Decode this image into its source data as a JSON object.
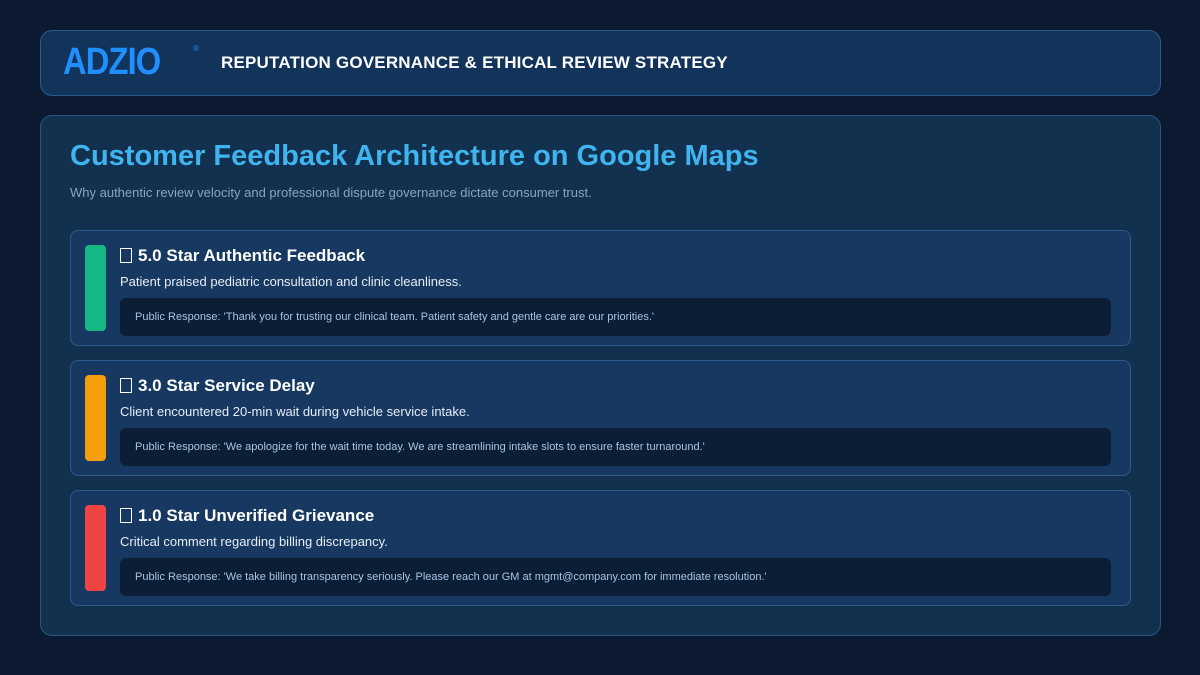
{
  "header": {
    "logo_text": "ADZIO",
    "logo_mark": "®",
    "title": "REPUTATION GOVERNANCE & ETHICAL REVIEW STRATEGY"
  },
  "main": {
    "title": "Customer Feedback Architecture on Google Maps",
    "subtitle": "Why authentic review velocity and professional dispute governance dictate consumer trust."
  },
  "reviews": [
    {
      "icon": "star-icon",
      "title": "5.0 Star Authentic Feedback",
      "description": "Patient praised pediatric consultation and clinic cleanliness.",
      "response": "Public Response: 'Thank you for trusting our clinical team. Patient safety and gentle care are our priorities.'",
      "color": "#14b884"
    },
    {
      "icon": "star-icon",
      "title": "3.0 Star Service Delay",
      "description": "Client encountered 20-min wait during vehicle service intake.",
      "response": "Public Response: 'We apologize for the wait time today. We are streamlining intake slots to ensure faster turnaround.'",
      "color": "#f59e0b"
    },
    {
      "icon": "star-icon",
      "title": "1.0 Star Unverified Grievance",
      "description": "Critical comment regarding billing discrepancy.",
      "response": "Public Response: 'We take billing transparency seriously. Please reach our GM at mgmt@company.com for immediate resolution.'",
      "color": "#ef4444"
    }
  ]
}
